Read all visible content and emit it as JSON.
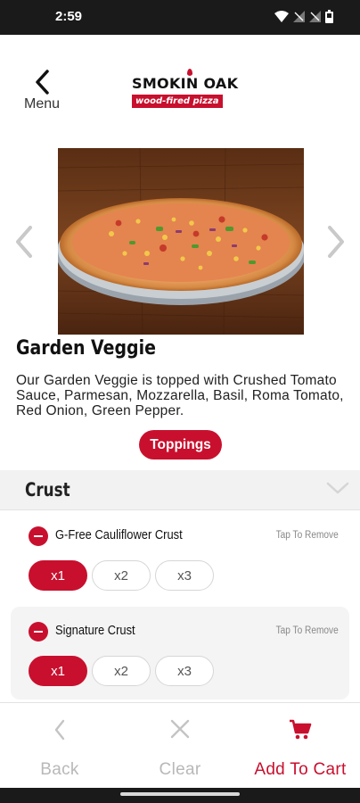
{
  "status": {
    "time": "2:59"
  },
  "header": {
    "menu_label": "Menu",
    "logo_top": "SMOKIN OAK",
    "logo_sub": "wood-fired pizza"
  },
  "item": {
    "title": "Garden Veggie",
    "description": "Our Garden Veggie is topped with Crushed Tomato Sauce, Parmesan, Mozzarella, Basil, Roma Tomato, Red Onion, Green Pepper.",
    "toppings_label": "Toppings"
  },
  "crust": {
    "title": "Crust",
    "options": [
      {
        "name": "G-Free Cauliflower Crust",
        "action": "Tap To Remove",
        "quantities": [
          "x1",
          "x2",
          "x3"
        ],
        "selected": "x1"
      },
      {
        "name": "Signature Crust",
        "action": "Tap To Remove",
        "quantities": [
          "x1",
          "x2",
          "x3"
        ],
        "selected": "x1"
      }
    ]
  },
  "bottom_bar": {
    "back_label": "Back",
    "clear_label": "Clear",
    "cart_label": "Add To Cart"
  },
  "colors": {
    "brand_red": "#c8102e",
    "muted": "#b8b8b8"
  },
  "icons": [
    "back-arrow-icon",
    "chevron-left-icon",
    "chevron-right-icon",
    "minus-circle-icon",
    "chevron-down-icon",
    "close-icon",
    "cart-icon",
    "wifi-icon",
    "signal-icon",
    "battery-icon"
  ]
}
